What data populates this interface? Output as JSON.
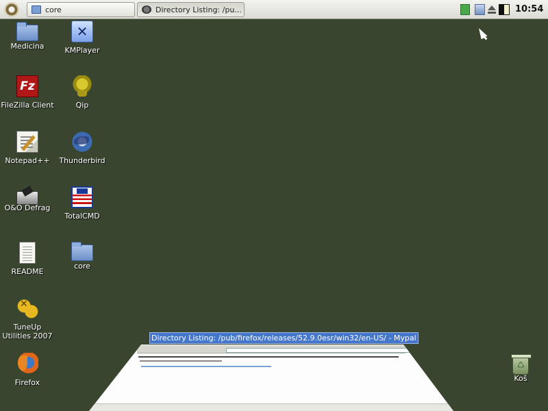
{
  "panel": {
    "tasks": [
      {
        "label": "core",
        "icon": "folder-icon"
      },
      {
        "label": "Directory Listing: /pu...",
        "icon": "browser-icon"
      }
    ],
    "clock": "10:54"
  },
  "desktop": {
    "icons": [
      {
        "label": "Medicina",
        "icon": "folder-icon"
      },
      {
        "label": "KMPlayer",
        "icon": "kmplayer-icon"
      },
      {
        "label": "FileZilla Client",
        "icon": "filezilla-icon"
      },
      {
        "label": "Qip",
        "icon": "qip-icon"
      },
      {
        "label": "Notepad++",
        "icon": "notepad-icon"
      },
      {
        "label": "Thunderbird",
        "icon": "thunderbird-icon"
      },
      {
        "label": "O&O Defrag",
        "icon": "defrag-icon"
      },
      {
        "label": "TotalCMD",
        "icon": "totalcmd-icon"
      },
      {
        "label": "README",
        "icon": "document-icon"
      },
      {
        "label": "core",
        "icon": "folder-icon"
      },
      {
        "label": "TuneUp Utilities 2007",
        "icon": "tuneup-icon"
      },
      {
        "label": "Firefox",
        "icon": "firefox-icon"
      },
      {
        "label": "Koš",
        "icon": "trash-icon"
      }
    ]
  },
  "switcher": {
    "window_title": "Directory Listing: /pub/firefox/releases/52.9.0esr/win32/en-US/ - Mypal"
  },
  "colors": {
    "desktop_background": "#3a4530",
    "highlight": "#4477cc"
  }
}
